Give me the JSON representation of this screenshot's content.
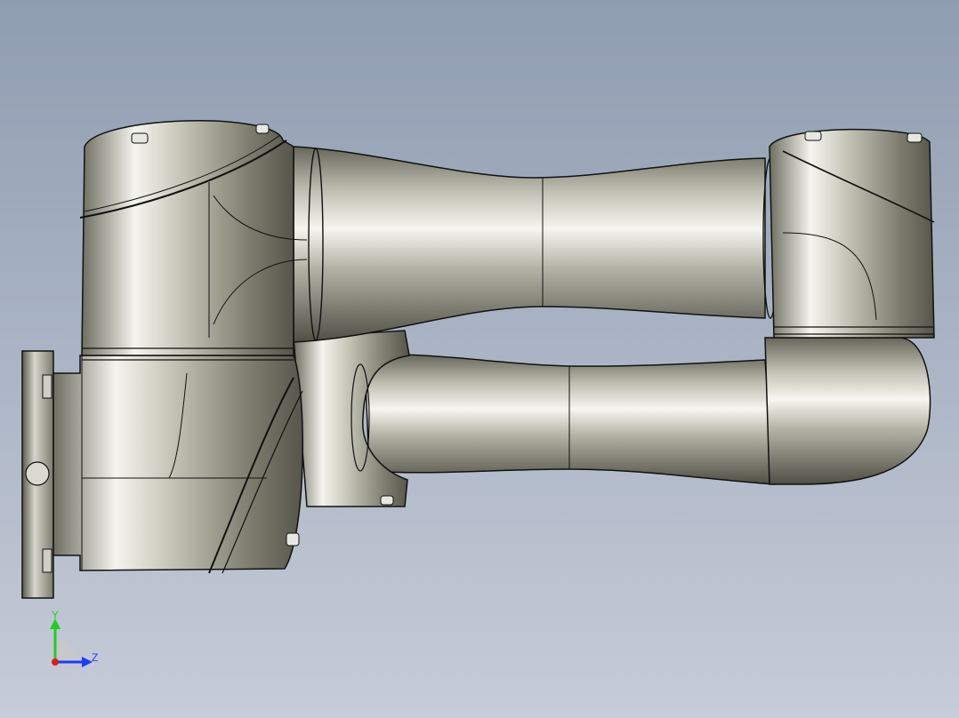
{
  "viewport": {
    "background_top": "#8f9db1",
    "background_bottom": "#c6ccd8"
  },
  "model": {
    "metal_light": "#f4f4ee",
    "metal_mid": "#b8b8aa",
    "metal_dark": "#5b5b50",
    "edge_color": "#111111"
  },
  "triad": {
    "y_label": "Y",
    "z_label": "Z",
    "y_color": "#22cc22",
    "z_color": "#1a3cff",
    "x_color": "#e01b1b",
    "icons": [
      "y-axis-arrow",
      "z-axis-arrow",
      "x-axis-dot"
    ]
  }
}
